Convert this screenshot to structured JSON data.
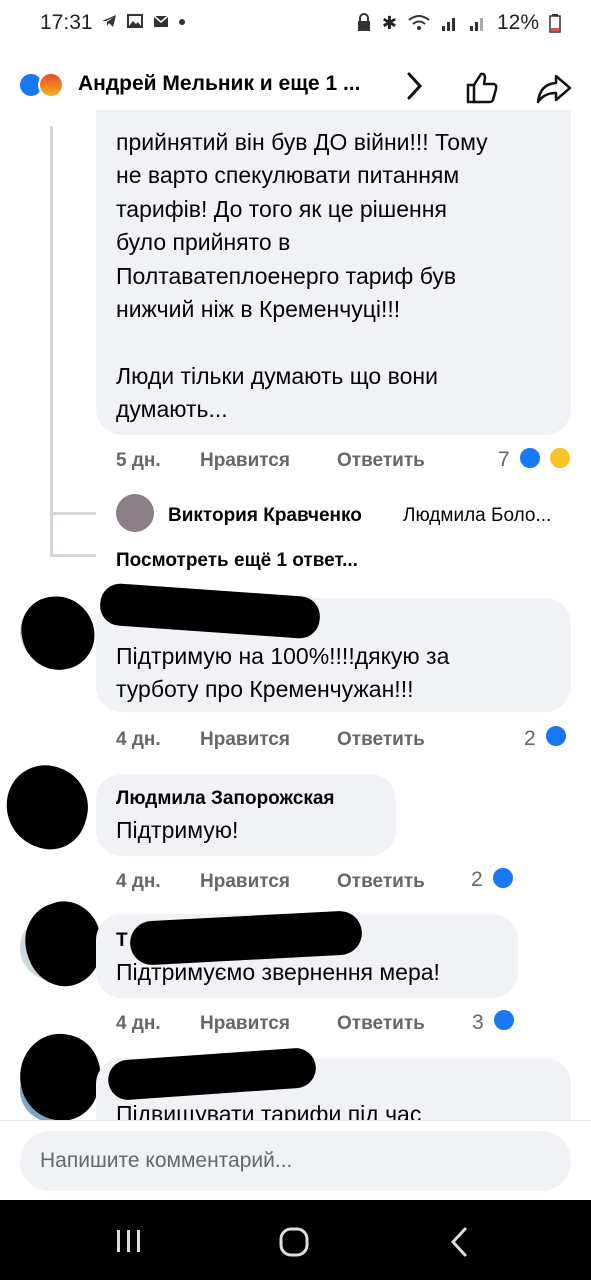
{
  "status_bar": {
    "time": "17:31",
    "battery": "12%",
    "left_icons": [
      "telegram-icon",
      "gallery-icon",
      "mail-icon",
      "dot-icon"
    ],
    "right_icons": [
      "lock-icon",
      "bluetooth-icon",
      "wifi-icon",
      "signal-icon",
      "signal-icon",
      "battery-icon"
    ]
  },
  "header": {
    "title": "Андрей Мельник и еще 1 ..."
  },
  "comments": [
    {
      "lines": [
        "прийнятий він був ДО війни!!! Тому",
        "не варто спекулювати питанням",
        "тарифів! До того як це рішення",
        "було прийнято в",
        "Полтаватеплоенерго тариф був",
        "нижчий ніж в Кременчуці!!!",
        "",
        "Люди тільки думають що вони",
        "думають..."
      ],
      "time": "5 дн.",
      "like": "Нравится",
      "reply": "Ответить",
      "reactions": "7"
    },
    {
      "name": "Виктория Кравченко",
      "preview": "Людмила Боло..."
    },
    {
      "more_replies": "Посмотреть ещё 1 ответ..."
    },
    {
      "lines": [
        "Підтримую на 100%!!!!дякую за",
        "турботу про Кременчужан!!!"
      ],
      "time": "4 дн.",
      "like": "Нравится",
      "reply": "Ответить",
      "reactions": "2"
    },
    {
      "name": "Людмила Запорожская",
      "lines": [
        "Підтримую!"
      ],
      "time": "4 дн.",
      "like": "Нравится",
      "reply": "Ответить",
      "reactions": "2"
    },
    {
      "name": "Т",
      "lines": [
        "Підтримуємо звернення мера!"
      ],
      "time": "4 дн.",
      "like": "Нравится",
      "reply": "Ответить",
      "reactions": "3"
    },
    {
      "lines": [
        "Підвищувати тарифи під час"
      ]
    }
  ],
  "composer": {
    "placeholder": "Напишите комментарий..."
  },
  "colors": {
    "accent": "#1877f2",
    "bubble": "#f0f2f5",
    "meta_text": "#65676b"
  }
}
